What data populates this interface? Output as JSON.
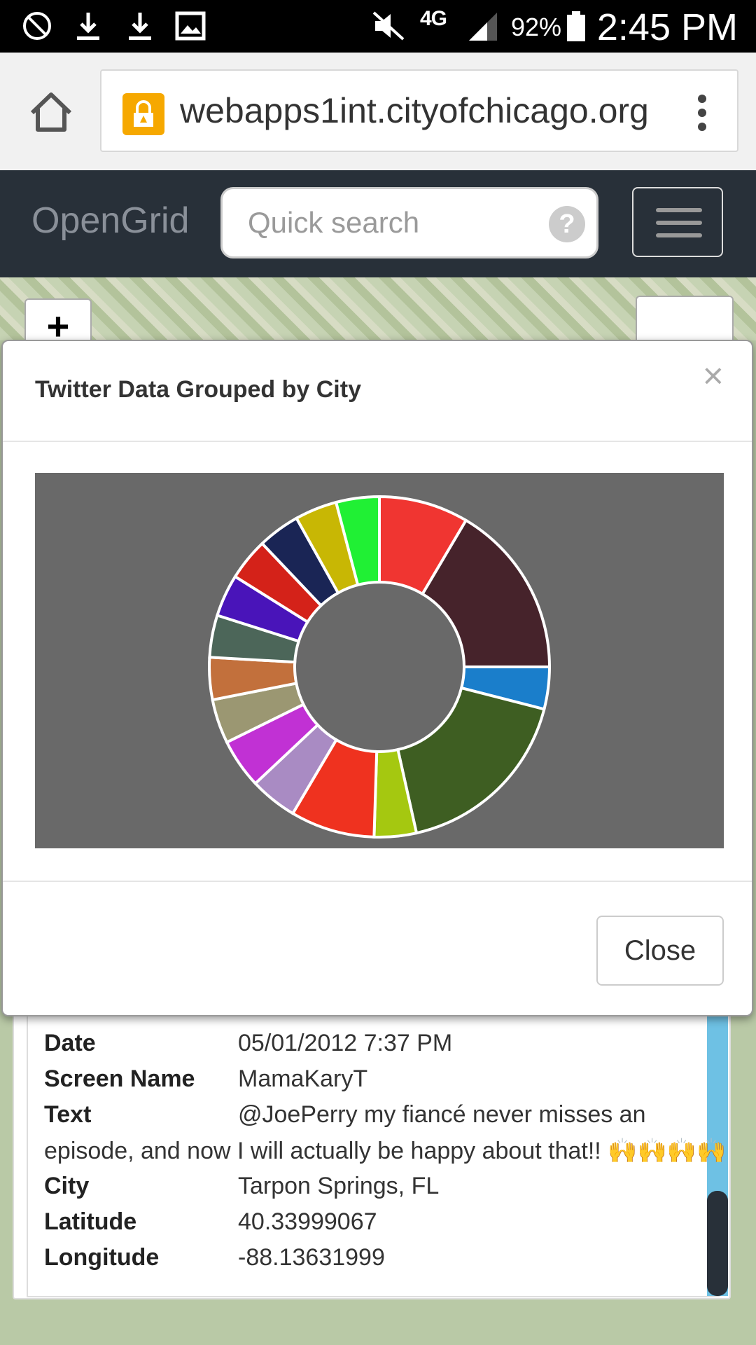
{
  "status_bar": {
    "time": "2:45 PM",
    "battery": "92%",
    "network": "4G",
    "icons": [
      "block-icon",
      "download-icon",
      "download-icon",
      "image-icon",
      "mute-icon",
      "signal-icon",
      "battery-icon"
    ]
  },
  "browser": {
    "url": "webapps1int.cityofchicago.org",
    "icons": [
      "home-icon",
      "lock-icon",
      "more-vert-icon"
    ]
  },
  "navbar": {
    "brand": "OpenGrid",
    "search_placeholder": "Quick search",
    "help_glyph": "?"
  },
  "map": {
    "zoom_in": "+"
  },
  "modal": {
    "title": "Twitter Data Grouped by City",
    "close_x": "×",
    "close_button": "Close"
  },
  "chart_data": {
    "type": "pie",
    "donut": true,
    "start_angle_deg": 0,
    "slices": [
      {
        "value": 8.5,
        "color": "#f03531"
      },
      {
        "value": 16.5,
        "color": "#46232b"
      },
      {
        "value": 4.0,
        "color": "#1a7ecb"
      },
      {
        "value": 17.5,
        "color": "#3e5e22"
      },
      {
        "value": 4.0,
        "color": "#a5c810"
      },
      {
        "value": 8.0,
        "color": "#ef321f"
      },
      {
        "value": 4.5,
        "color": "#a98bc3"
      },
      {
        "value": 4.7,
        "color": "#c131d4"
      },
      {
        "value": 4.2,
        "color": "#9b9772"
      },
      {
        "value": 4.0,
        "color": "#c2703c"
      },
      {
        "value": 4.0,
        "color": "#4c6659"
      },
      {
        "value": 4.0,
        "color": "#4914b9"
      },
      {
        "value": 4.0,
        "color": "#d42219"
      },
      {
        "value": 4.0,
        "color": "#1a2555"
      },
      {
        "value": 4.0,
        "color": "#c8b704"
      },
      {
        "value": 4.1,
        "color": "#20f034"
      }
    ]
  },
  "record": {
    "fields": [
      {
        "key": "Date",
        "value": "05/01/2012 7:37 PM"
      },
      {
        "key": "Screen Name",
        "value": "MamaKaryT"
      },
      {
        "key": "Text",
        "value": "@JoePerry my fiancé never misses an"
      },
      {
        "key": "",
        "value": "episode, and now I will actually be happy about that!! 🙌🙌🙌🙌"
      },
      {
        "key": "City",
        "value": "Tarpon Springs, FL"
      },
      {
        "key": "Latitude",
        "value": "40.33999067"
      },
      {
        "key": "Longitude",
        "value": "-88.13631999"
      }
    ]
  }
}
